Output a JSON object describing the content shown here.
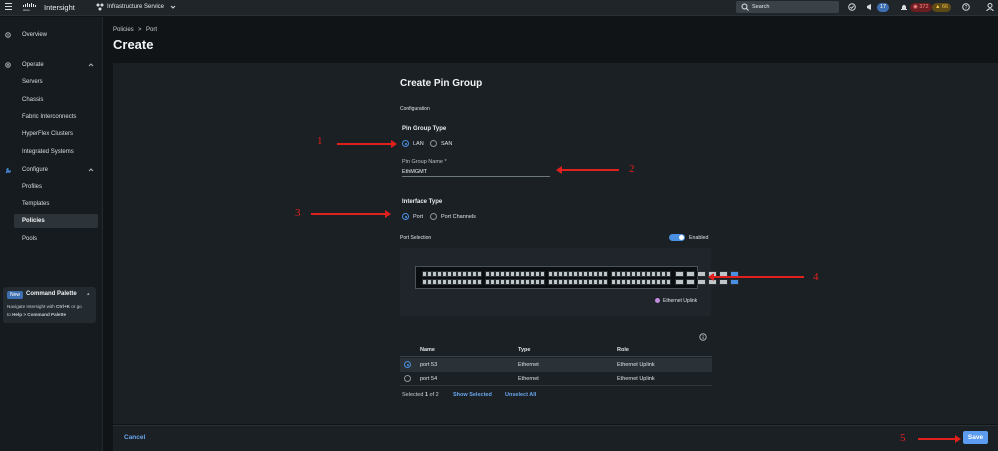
{
  "topbar": {
    "brand": "Intersight",
    "service": "Infrastructure Service",
    "search_placeholder": "Search",
    "tasks_count": "17",
    "alarm_critical": "372",
    "alarm_warning": "66"
  },
  "sidebar": {
    "overview": "Overview",
    "operate": "Operate",
    "operate_items": [
      "Servers",
      "Chassis",
      "Fabric Interconnects",
      "HyperFlex Clusters",
      "Integrated Systems"
    ],
    "configure": "Configure",
    "configure_items": [
      "Profiles",
      "Templates",
      "Policies",
      "Pools"
    ],
    "command_palette": {
      "badge": "New",
      "title": "Command Palette",
      "line1_pre": "Navigate Intersight with ",
      "line1_key": "Ctrl+K",
      "line1_post": " or go",
      "line2_pre": "to ",
      "line2_key": "Help > Command Palette"
    }
  },
  "breadcrumb": {
    "item1": "Policies",
    "separator": ">",
    "item2": "Port"
  },
  "page_title": "Create",
  "form": {
    "title": "Create Pin Group",
    "section": "Configuration",
    "pin_group_type_label": "Pin Group Type",
    "opt_lan": "LAN",
    "opt_san": "SAN",
    "pin_group_name_label": "Pin Group Name *",
    "pin_group_name_value": "EthMGMT",
    "interface_type_label": "Interface Type",
    "opt_port": "Port",
    "opt_port_channels": "Port Channels",
    "port_selection_label": "Port Selection",
    "enabled_label": "Enabled",
    "legend": "Ethernet Uplink"
  },
  "table": {
    "headers": [
      "Name",
      "Type",
      "Role"
    ],
    "rows": [
      {
        "name": "port 53",
        "type": "Ethernet",
        "role": "Ethernet Uplink"
      },
      {
        "name": "port 54",
        "type": "Ethernet",
        "role": "Ethernet Uplink"
      }
    ],
    "selected_pre": "Selected ",
    "selected_count": "1",
    "selected_post": " of 2",
    "show_selected": "Show Selected",
    "unselect_all": "Unselect All"
  },
  "footer": {
    "cancel": "Cancel",
    "save": "Save"
  },
  "annotations": [
    "1",
    "2",
    "3",
    "4",
    "5"
  ],
  "colors": {
    "accent": "#4a90e2",
    "arrow": "#e0201c",
    "save": "#5b9bf0"
  }
}
